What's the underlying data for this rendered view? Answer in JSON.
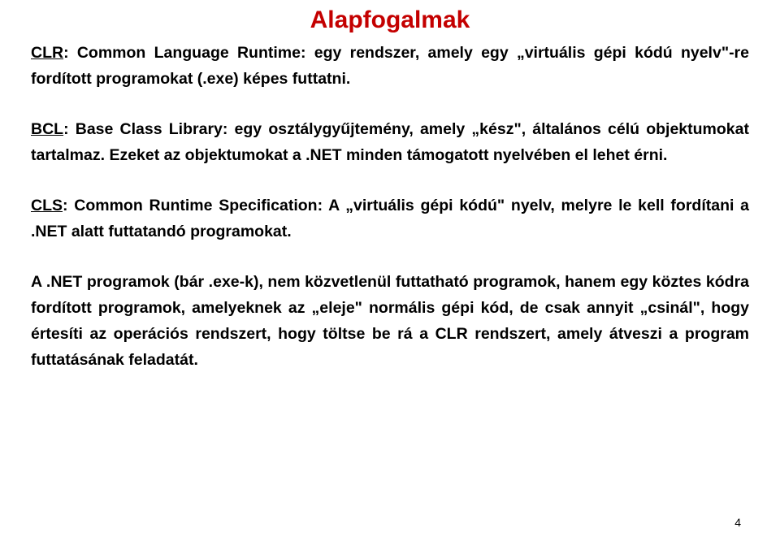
{
  "title": "Alapfogalmak",
  "paragraphs": {
    "p1": {
      "term": "CLR",
      "rest": ": Common Language Runtime: egy rendszer, amely egy „virtuális gépi kódú nyelv\"-re fordított programokat (.exe) képes futtatni."
    },
    "p2": {
      "term": "BCL",
      "rest": ": Base Class Library: egy osztálygyűjtemény, amely „kész\", általános célú objektumokat tartalmaz. Ezeket az objektumokat a .NET minden támogatott nyelvében el lehet érni."
    },
    "p3": {
      "term": "CLS",
      "rest": ": Common Runtime Specification: A „virtuális gépi kódú\" nyelv, melyre le kell fordítani a .NET alatt futtatandó programokat."
    },
    "p4": {
      "full": "A .NET programok (bár .exe-k), nem közvetlenül futtatható programok, hanem egy köztes kódra fordított programok, amelyeknek az „eleje\" normális gépi kód, de csak annyit „csinál\", hogy értesíti az operációs rendszert, hogy töltse be rá a CLR rendszert, amely átveszi a program futtatásának feladatát."
    }
  },
  "page_number": "4"
}
